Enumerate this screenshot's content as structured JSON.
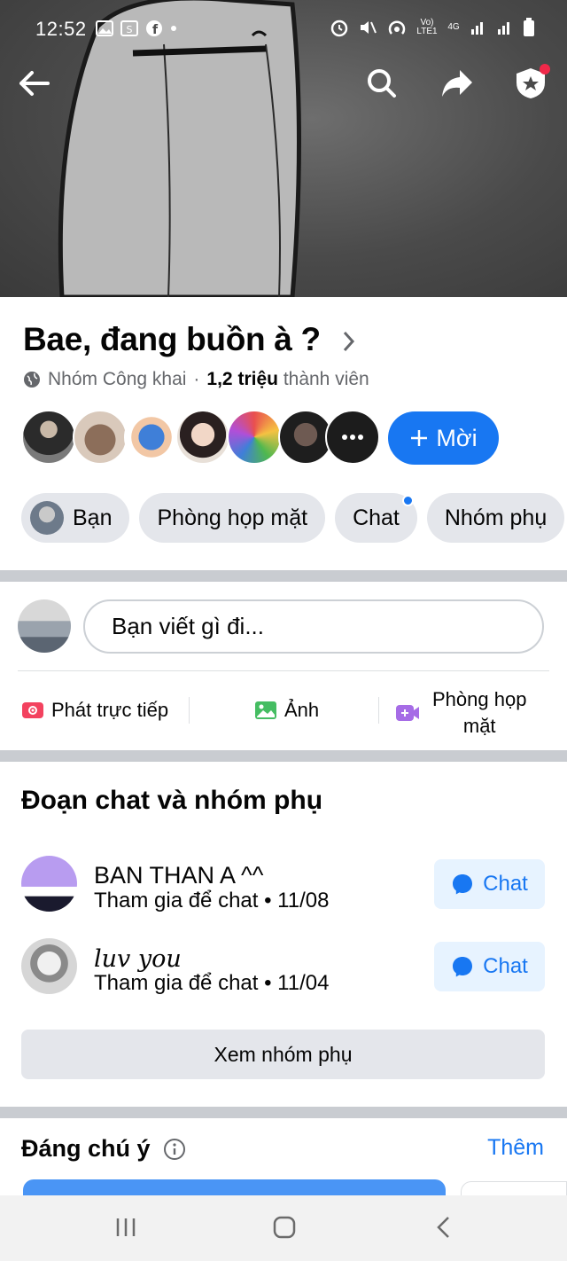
{
  "status_bar": {
    "time": "12:52",
    "carrier_small_1": "Vo) LTE1",
    "carrier_small_2": "4G"
  },
  "group": {
    "title": "Bae, đang buồn à ?",
    "privacy": "Nhóm Công khai",
    "members_count": "1,2 triệu",
    "members_label": "thành viên",
    "invite_label": "Mời"
  },
  "chips": [
    {
      "label": "Bạn"
    },
    {
      "label": "Phòng họp mặt"
    },
    {
      "label": "Chat"
    },
    {
      "label": "Nhóm phụ"
    }
  ],
  "composer": {
    "placeholder": "Bạn viết gì đi..."
  },
  "actions": {
    "live": "Phát trực tiếp",
    "photo": "Ảnh",
    "room_line1": "Phòng họp",
    "room_line2": "mặt"
  },
  "chats_section": {
    "title": "Đoạn chat và nhóm phụ",
    "items": [
      {
        "name": "BAN THAN A ^^",
        "subtitle": "Tham gia để chat • 11/08",
        "button": "Chat"
      },
      {
        "name": "luv you",
        "subtitle": "Tham gia để chat • 11/04",
        "button": "Chat"
      }
    ],
    "see_all": "Xem nhóm phụ"
  },
  "noteworthy": {
    "title": "Đáng chú ý",
    "more": "Thêm"
  },
  "colors": {
    "accent": "#1877f2",
    "chip_bg": "#e4e6eb",
    "separator": "#c9ccd1"
  }
}
